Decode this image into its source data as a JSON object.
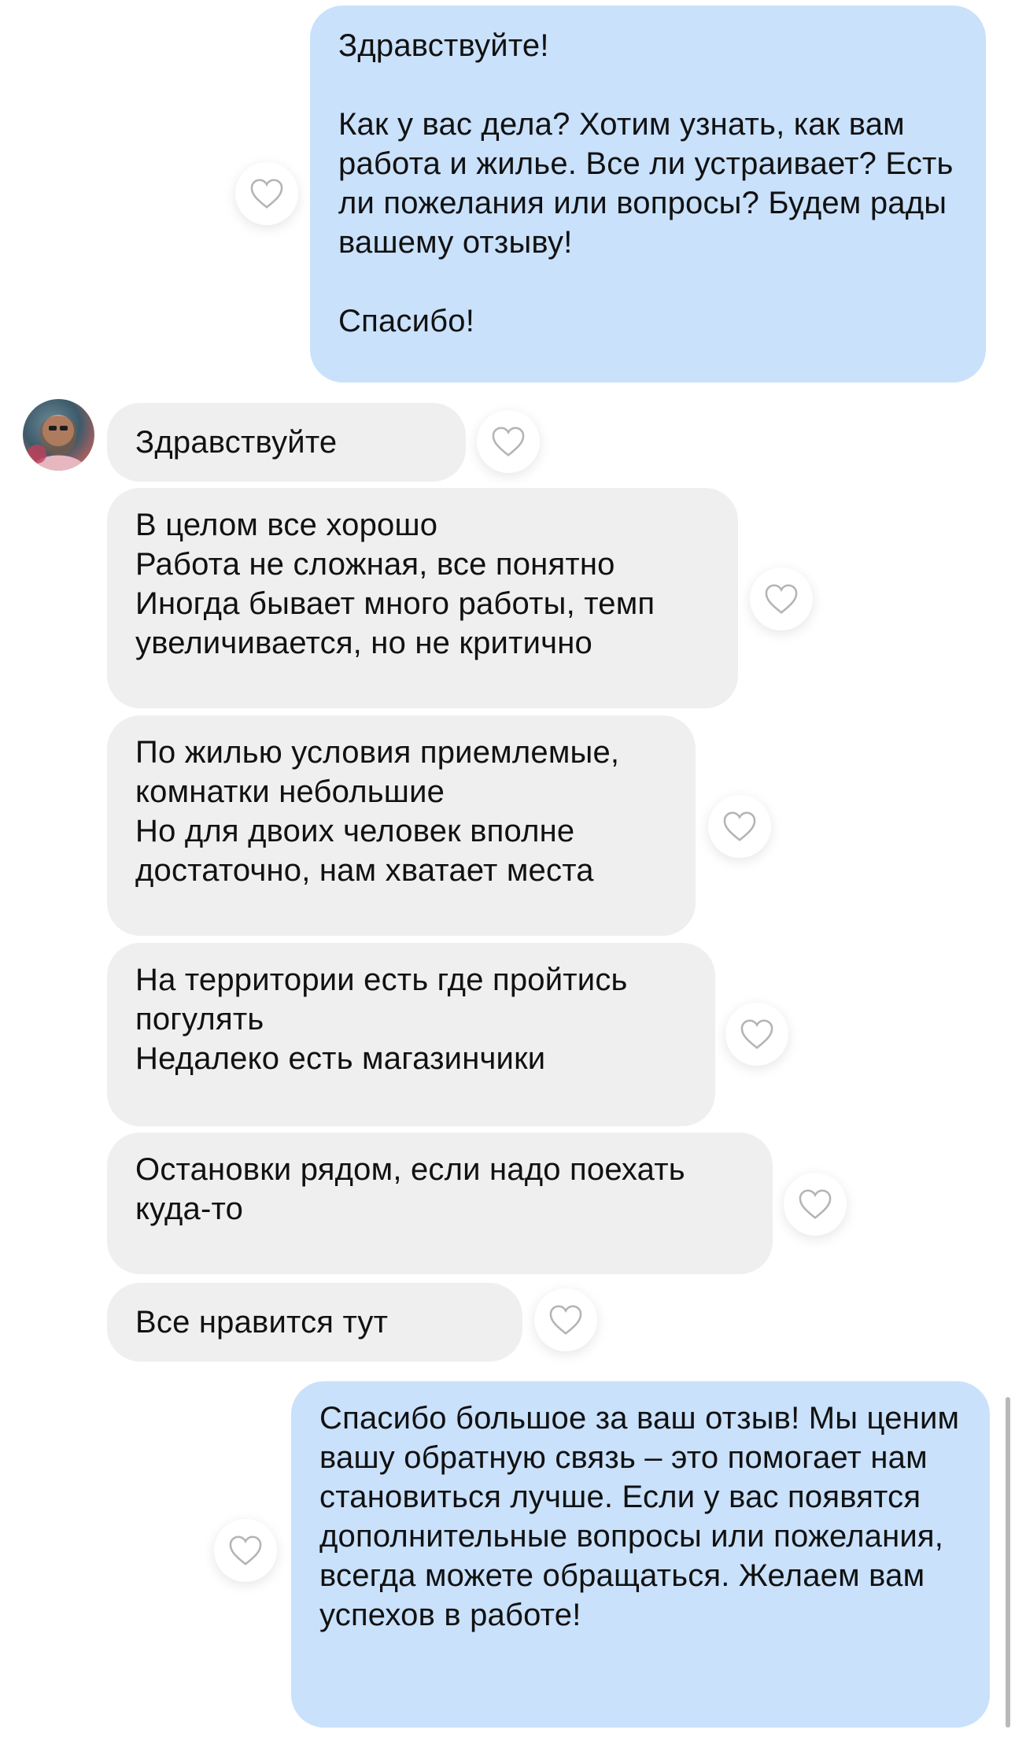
{
  "chat": {
    "messages": [
      {
        "id": "m1",
        "direction": "outgoing",
        "text": "Здравствуйте!\n\nКак у вас дела? Хотим узнать, как вам работа и жилье. Все ли устраивает? Есть ли пожелания или вопросы? Будем рады вашему отзыву!\n\nСпасибо!"
      },
      {
        "id": "m2",
        "direction": "incoming",
        "text": "Здравствуйте"
      },
      {
        "id": "m3",
        "direction": "incoming",
        "text": "В целом все хорошо\nРабота не сложная, все понятно\nИногда бывает много работы, темп увеличивается, но не критично"
      },
      {
        "id": "m4",
        "direction": "incoming",
        "text": "По жилью условия приемлемые, комнатки небольшие\nНо для двоих человек вполне достаточно, нам хватает места"
      },
      {
        "id": "m5",
        "direction": "incoming",
        "text": "На территории есть где пройтись погулять\nНедалеко есть магазинчики"
      },
      {
        "id": "m6",
        "direction": "incoming",
        "text": "Остановки рядом, если надо поехать куда-то"
      },
      {
        "id": "m7",
        "direction": "incoming",
        "text": "Все нравится тут"
      },
      {
        "id": "m8",
        "direction": "outgoing",
        "text": "Спасибо большое за ваш отзыв! Мы ценим вашу обратную связь – это помогает нам становиться лучше. Если у вас появятся дополнительные вопросы или пожелания, всегда можете обращаться. Желаем вам успехов в работе!"
      }
    ],
    "like_icon": "heart-outline-icon",
    "colors": {
      "outgoing_bubble": "#c9e1fb",
      "incoming_bubble": "#efefef",
      "text": "#111111"
    }
  }
}
